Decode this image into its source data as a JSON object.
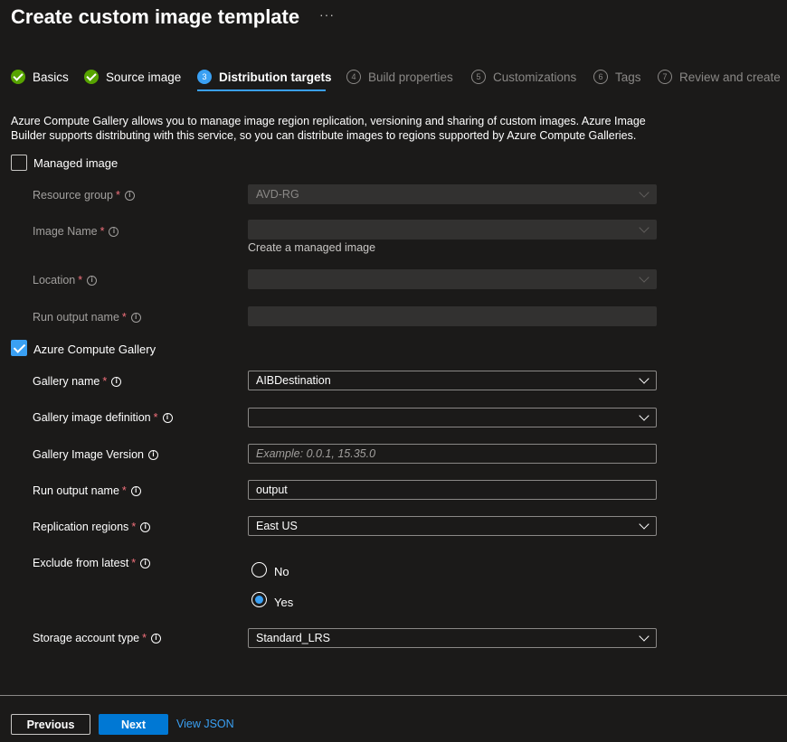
{
  "page": {
    "title": "Create custom image template",
    "more": "···"
  },
  "tabs": [
    {
      "num": "",
      "label": "Basics",
      "state": "done"
    },
    {
      "num": "",
      "label": "Source image",
      "state": "done"
    },
    {
      "num": "3",
      "label": "Distribution targets",
      "state": "active"
    },
    {
      "num": "4",
      "label": "Build properties",
      "state": "pending"
    },
    {
      "num": "5",
      "label": "Customizations",
      "state": "pending"
    },
    {
      "num": "6",
      "label": "Tags",
      "state": "pending"
    },
    {
      "num": "7",
      "label": "Review and create",
      "state": "pending"
    }
  ],
  "description": "Azure Compute Gallery allows you to manage image region replication, versioning and sharing of custom images. Azure Image Builder supports distributing with this service, so you can distribute images to regions supported by Azure Compute Galleries.",
  "managed_image": {
    "label": "Managed image",
    "checked": false,
    "resource_group": {
      "label": "Resource group",
      "value": "AVD-RG"
    },
    "image_name": {
      "label": "Image Name",
      "value": "",
      "hint": "Create a managed image"
    },
    "location": {
      "label": "Location",
      "value": ""
    },
    "run_output_name": {
      "label": "Run output name",
      "value": ""
    }
  },
  "compute_gallery": {
    "label": "Azure Compute Gallery",
    "checked": true,
    "gallery_name": {
      "label": "Gallery name",
      "value": "AIBDestination"
    },
    "gallery_image_definition": {
      "label": "Gallery image definition",
      "value": ""
    },
    "gallery_image_version": {
      "label": "Gallery Image Version",
      "placeholder": "Example: 0.0.1, 15.35.0"
    },
    "run_output_name": {
      "label": "Run output name",
      "value": "output"
    },
    "replication_regions": {
      "label": "Replication regions",
      "value": "East US"
    },
    "exclude_from_latest": {
      "label": "Exclude from latest",
      "options": [
        "No",
        "Yes"
      ],
      "selected": "Yes"
    },
    "storage_account_type": {
      "label": "Storage account type",
      "value": "Standard_LRS"
    }
  },
  "footer": {
    "previous": "Previous",
    "next": "Next",
    "view_json": "View JSON"
  },
  "symbols": {
    "required": "*",
    "info": "i"
  },
  "colors": {
    "accent": "#3aa0f3",
    "primary_button": "#0078d4",
    "success": "#57a300",
    "required": "#f1707b",
    "background": "#1b1a19"
  }
}
